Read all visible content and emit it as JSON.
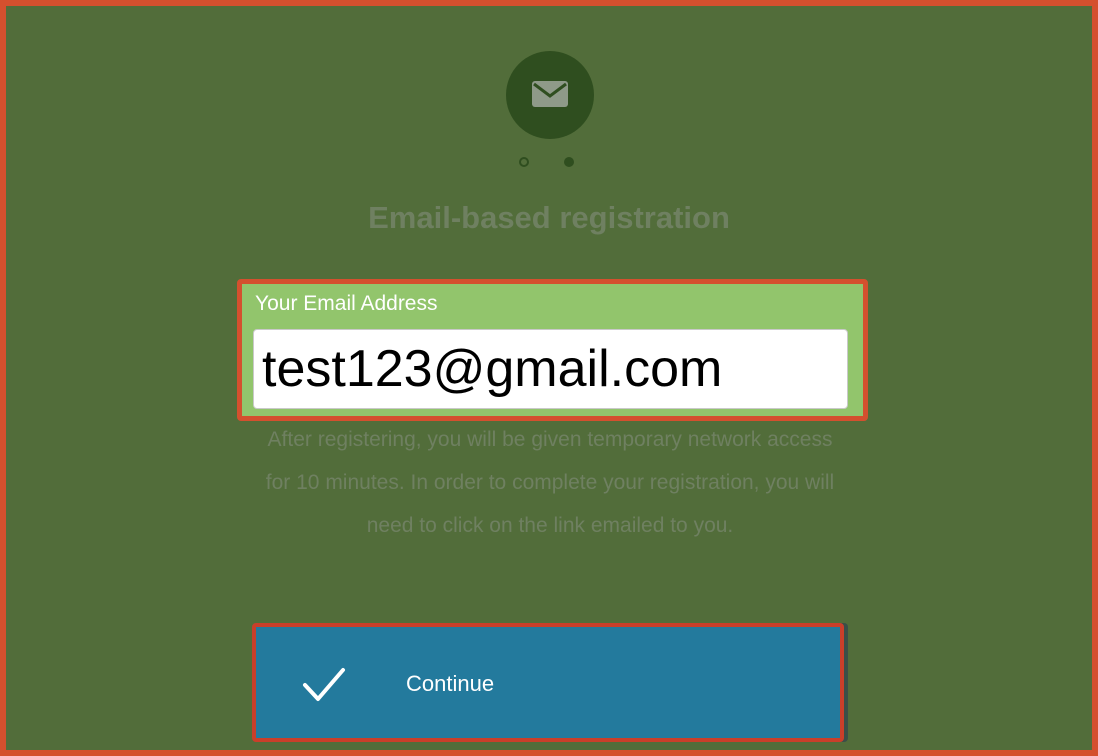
{
  "header": {
    "icon": "envelope-icon",
    "steps": [
      {
        "state": "empty"
      },
      {
        "state": "filled"
      }
    ],
    "title": "Email-based registration"
  },
  "email_field": {
    "label": "Your Email Address",
    "value": "test123@gmail.com"
  },
  "info_text": "After registering, you will be given temporary network access for 10 minutes. In order to complete your registration, you will need to click on the link emailed to you.",
  "continue_button": {
    "icon": "checkmark-icon",
    "label": "Continue"
  },
  "colors": {
    "background": "#526d3a",
    "highlight_border": "#d4502e",
    "field_background": "#92c56c",
    "button": "#237a9d"
  }
}
